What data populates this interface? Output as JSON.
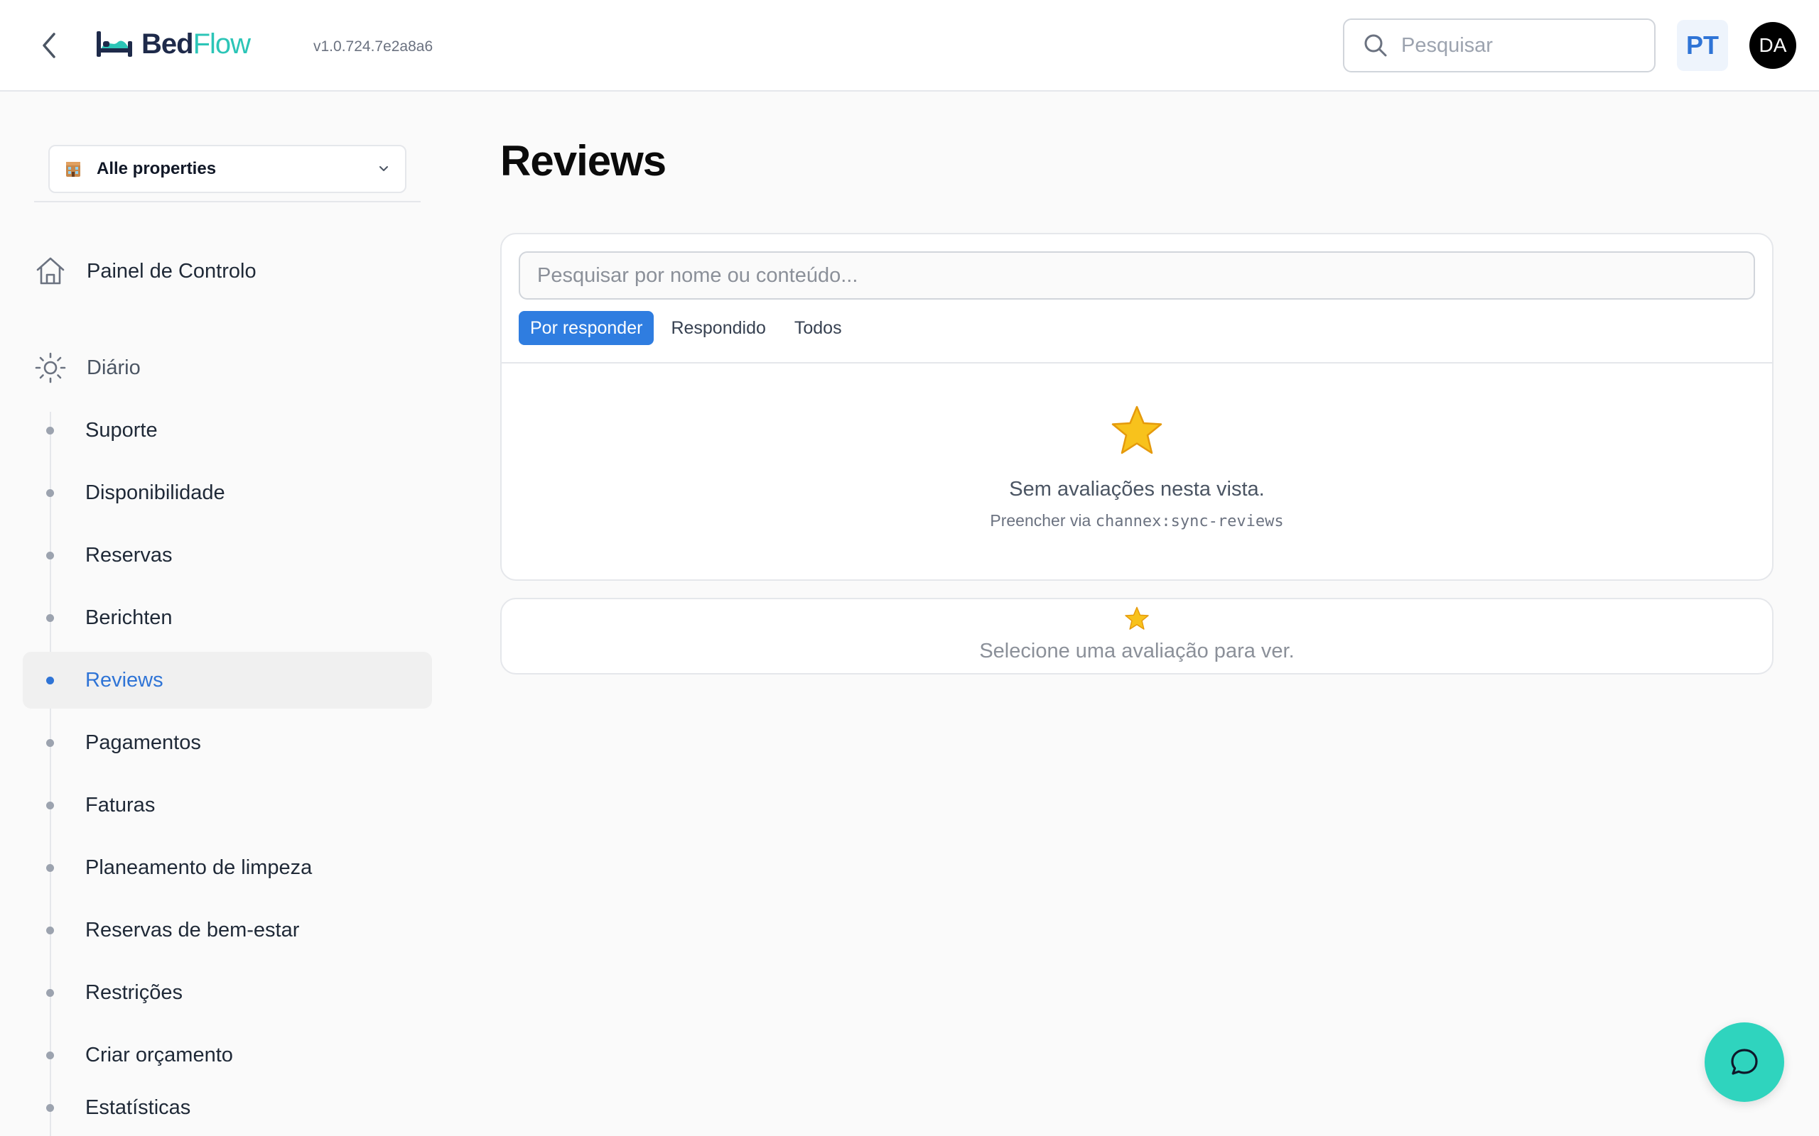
{
  "header": {
    "back_icon": "chevron-left-icon",
    "logo_icon": "bed-icon",
    "logo_bed": "Bed",
    "logo_flow": "Flow",
    "version": "v1.0.724.7e2a8a6",
    "search_placeholder": "Pesquisar",
    "language": "PT",
    "avatar_initials": "DA"
  },
  "sidebar": {
    "property_selector": {
      "icon": "hotel-emoji",
      "label": "Alle properties"
    },
    "dashboard": {
      "icon": "home-icon",
      "label": "Painel de Controlo"
    },
    "group": {
      "icon": "sun-icon",
      "label": "Diário"
    },
    "items": [
      {
        "label": "Suporte",
        "active": false
      },
      {
        "label": "Disponibilidade",
        "active": false
      },
      {
        "label": "Reservas",
        "active": false
      },
      {
        "label": "Berichten",
        "active": false
      },
      {
        "label": "Reviews",
        "active": true
      },
      {
        "label": "Pagamentos",
        "active": false
      },
      {
        "label": "Faturas",
        "active": false
      },
      {
        "label": "Planeamento de limpeza",
        "active": false
      },
      {
        "label": "Reservas de bem-estar",
        "active": false
      },
      {
        "label": "Restrições",
        "active": false
      },
      {
        "label": "Criar orçamento",
        "active": false
      },
      {
        "label": "Estatísticas",
        "active": false
      }
    ]
  },
  "main": {
    "title": "Reviews",
    "search_placeholder": "Pesquisar por nome ou conteúdo...",
    "filters": [
      {
        "label": "Por responder",
        "active": true
      },
      {
        "label": "Respondido",
        "active": false
      },
      {
        "label": "Todos",
        "active": false
      }
    ],
    "empty": {
      "icon": "star-emoji",
      "message": "Sem avaliações nesta vista.",
      "hint_prefix": "Preencher via ",
      "hint_code": "channex:sync-reviews"
    },
    "detail": {
      "icon": "star-emoji",
      "message": "Selecione uma avaliação para ver."
    }
  },
  "chat": {
    "icon": "chat-bubble-icon"
  },
  "colors": {
    "accent": "#2f74d6",
    "brand_teal": "#2cc5b7",
    "chat_fab": "#2fd4be",
    "star": "#f5b800"
  }
}
